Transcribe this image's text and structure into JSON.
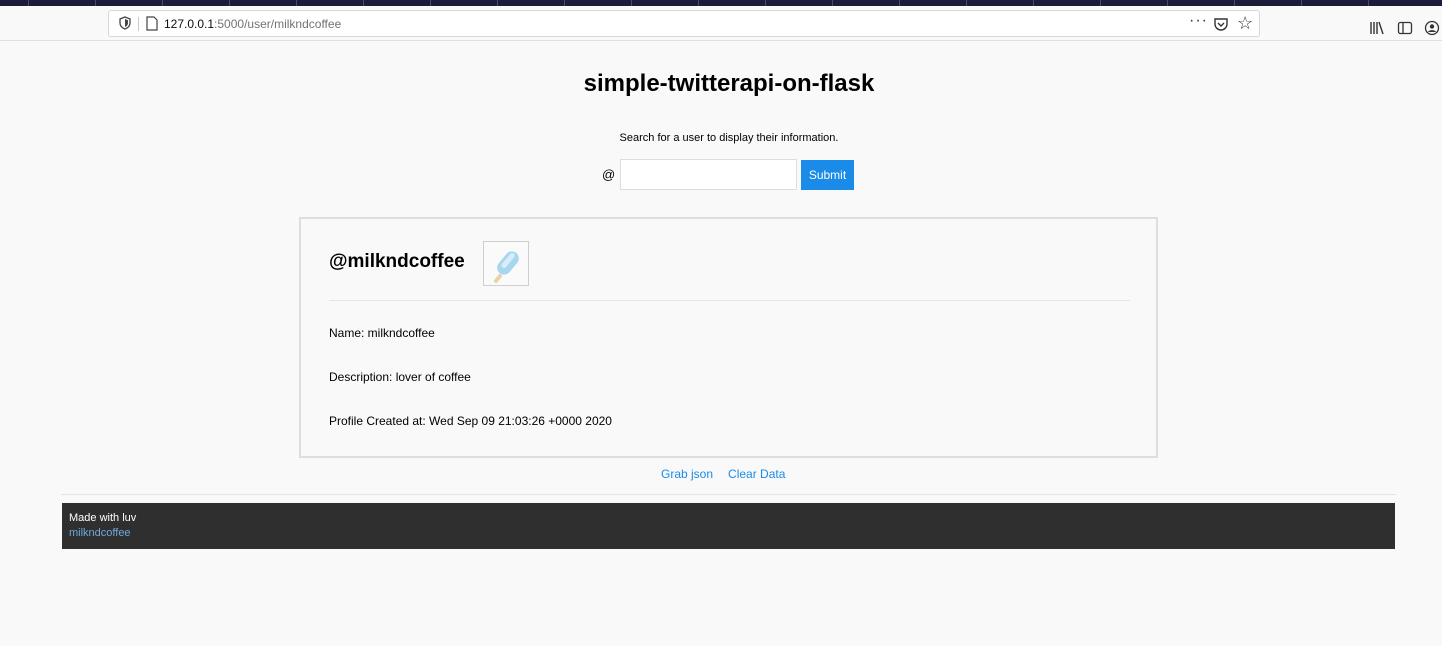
{
  "browser": {
    "url_host": "127.0.0.1",
    "url_rest": ":5000/user/milkndcoffee",
    "page_actions": "···"
  },
  "header": {
    "title": "simple-twitterapi-on-flask",
    "subtitle": "Search for a user to display their information."
  },
  "search": {
    "prefix": "@",
    "value": "",
    "submit_label": "Submit"
  },
  "profile": {
    "handle": "@milkndcoffee",
    "avatar_icon": "popsicle-icon",
    "name_line": "Name: milkndcoffee",
    "description_line": "Description: lover of coffee",
    "created_line": "Profile Created at: Wed Sep 09 21:03:26 +0000 2020"
  },
  "actions": {
    "grab_json": "Grab json",
    "clear_data": "Clear Data"
  },
  "footer": {
    "made_with": "Made with luv",
    "author": "milkndcoffee"
  },
  "colors": {
    "accent": "#1a8be8",
    "footer_bg": "#2f2f2f",
    "footer_link": "#6fa8dc"
  }
}
